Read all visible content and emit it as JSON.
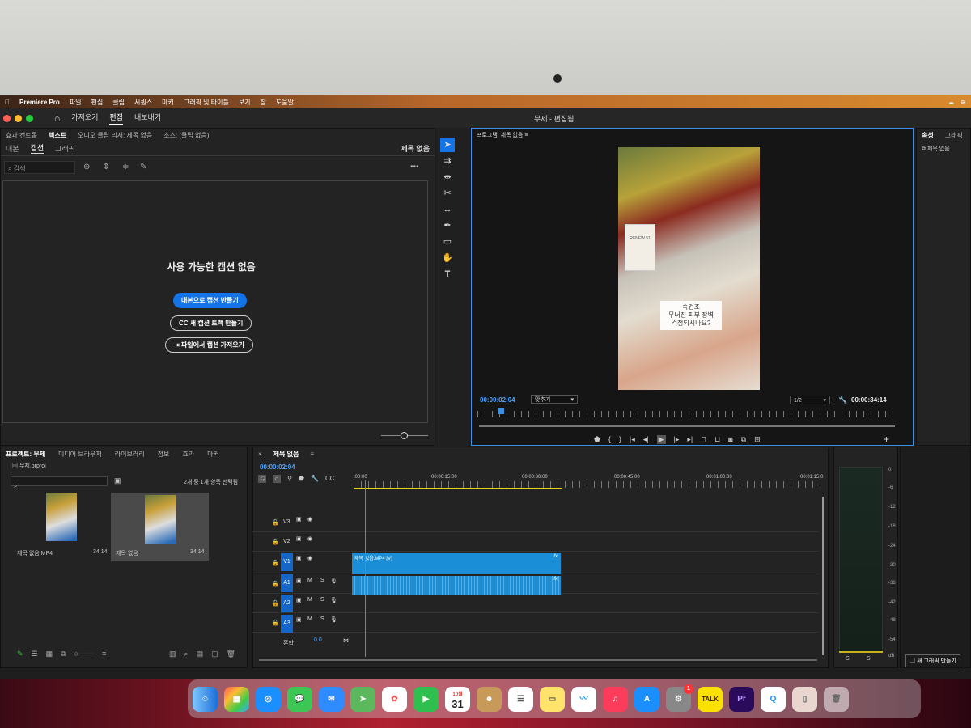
{
  "menubar": {
    "app": "Premiere Pro",
    "items": [
      "파일",
      "편집",
      "클립",
      "시퀀스",
      "마커",
      "그래픽 및 타이틀",
      "보기",
      "창",
      "도움말"
    ]
  },
  "titlebar": {
    "workspaces": [
      "가져오기",
      "편집",
      "내보내기"
    ],
    "active_workspace": "편집",
    "document_title": "무제 - 편집됨"
  },
  "text_panel": {
    "tabs": [
      "효과 컨트롤",
      "텍스트",
      "오디오 클립 믹서: 제목 없음",
      "소스: (클립 없음)"
    ],
    "subtabs": [
      "대본",
      "캡션",
      "그래픽"
    ],
    "active_subtab": "캡션",
    "sequence_label": "제목 없음",
    "search_placeholder": "검색",
    "empty_title": "사용 가능한 캡션 없음",
    "btn_transcript": "대본으로 캡션 만들기",
    "btn_new_track": "새 캡션 트랙 만들기",
    "btn_import": "파일에서 캡션 가져오기"
  },
  "program_monitor": {
    "title": "프로그램: 제목 없음",
    "caption_lines": [
      "속건조",
      "무너진 피부 장벽",
      "걱정되시나요?"
    ],
    "product_text": "RENEW 51",
    "timecode_current": "00:00:02:04",
    "fit": "맞추기",
    "resolution": "1/2",
    "timecode_duration": "00:00:34:14"
  },
  "properties_panel": {
    "tabs": [
      "속성",
      "그래픽"
    ],
    "item": "제목 없음"
  },
  "project_panel": {
    "tabs": [
      "프로젝트: 무제",
      "미디어 브라우저",
      "라이브러리",
      "정보",
      "효과",
      "마커"
    ],
    "file": "무제.prproj",
    "selection_info": "2개 중 1개 항목 선택됨",
    "items": [
      {
        "name": "제목 없음.MP4",
        "duration": "34:14"
      },
      {
        "name": "제목 없음",
        "duration": "34:14"
      }
    ]
  },
  "timeline": {
    "title": "제목 없음",
    "timecode": "00:00:02:04",
    "ruler_labels": [
      ":00:00",
      "00:00:15:00",
      "00:00:30:00",
      "00:00:45:00",
      "00:01:00:00",
      "00:01:15:0"
    ],
    "tracks": [
      "V3",
      "V2",
      "V1",
      "A1",
      "A2",
      "A3"
    ],
    "mix_label": "혼합",
    "mix_value": "0.0",
    "video_clip": "제목 없음.MP4 [V]"
  },
  "audio_meter": {
    "scale": [
      "0",
      "-6",
      "-12",
      "-18",
      "-24",
      "-30",
      "-36",
      "-42",
      "-48",
      "-54",
      "dB"
    ],
    "solo": [
      "S",
      "S"
    ],
    "new_graphic_btn": "새 그래픽 만들기"
  },
  "dock": {
    "calendar_month": "10월",
    "calendar_day": "31",
    "talk": "TALK",
    "pr": "Pr",
    "badge": "1"
  },
  "colors": {
    "accent": "#1473e6",
    "timeline_clip": "#1a8fd8",
    "monitor_border": "#3f8fe0",
    "menubar_orange": "#d98a2e"
  }
}
